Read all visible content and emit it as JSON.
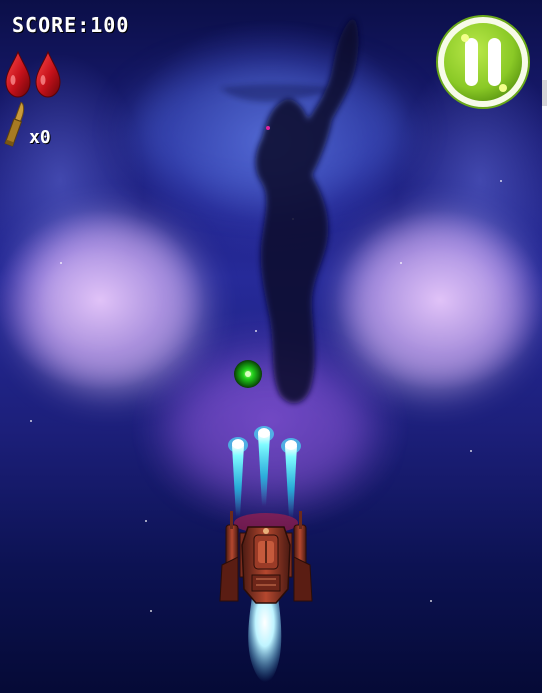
{
  "hud": {
    "score_label": "SCORE:100",
    "ammo_count_label": "x0",
    "lives_icon": "blood-drop-icon",
    "lives_remaining": 2,
    "ammo_icon": "bullet-icon",
    "pause_icon": "pause-icon"
  },
  "colors": {
    "pause_button_green": "#8ac926",
    "laser_cyan": "#3ff6ff",
    "enemy_orb_green": "#22d11c",
    "blood_red": "#c4111a",
    "ship_rust": "#8b2f22"
  },
  "scene": {
    "background": "space-nebula",
    "enemy": "green-energy-orb",
    "player": "red-spaceship",
    "player_shots_visible": 3
  }
}
